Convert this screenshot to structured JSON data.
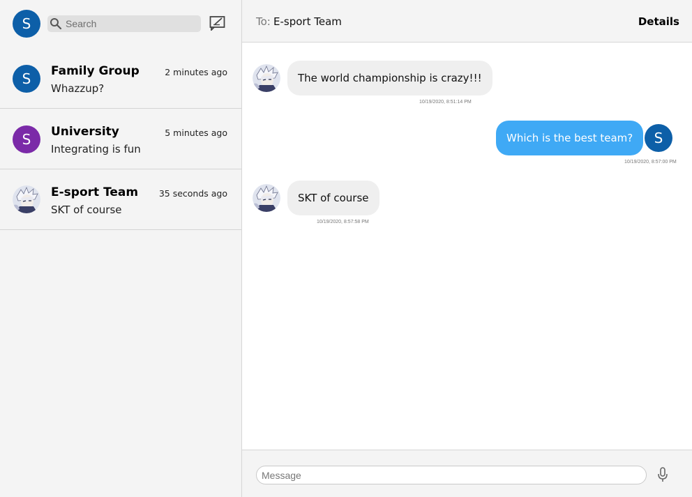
{
  "app": {
    "me_initial": "S"
  },
  "search": {
    "placeholder": "Search",
    "icon": "search-icon"
  },
  "compose": {
    "icon": "compose-icon"
  },
  "conversations": [
    {
      "name": "Family Group",
      "time": "2 minutes ago",
      "preview": "Whazzup?",
      "avatar_initial": "S",
      "avatar_color": "#0d5fa8"
    },
    {
      "name": "University",
      "time": "5 minutes ago",
      "preview": "Integrating is fun",
      "avatar_initial": "S",
      "avatar_color": "#7b2aa8"
    },
    {
      "name": "E-sport Team",
      "time": "35 seconds ago",
      "preview": "SKT of course",
      "avatar_image": "anime-character-avatar"
    }
  ],
  "chat": {
    "to_label": "To:",
    "to_name": "E-sport Team",
    "details_label": "Details",
    "messages": [
      {
        "direction": "incoming",
        "text": "The world championship is crazy!!!",
        "timestamp": "10/19/2020, 8:51:14 PM"
      },
      {
        "direction": "outgoing",
        "text": "Which is the best team?",
        "timestamp": "10/19/2020, 8:57:00 PM",
        "avatar_initial": "S"
      },
      {
        "direction": "incoming",
        "text": "SKT of course",
        "timestamp": "10/19/2020, 8:57:58 PM"
      }
    ]
  },
  "composer": {
    "placeholder": "Message",
    "mic_icon": "microphone-icon"
  },
  "colors": {
    "accent_blue": "#3fa9f5",
    "avatar_blue": "#0d5fa8",
    "avatar_purple": "#7b2aa8",
    "incoming_bubble": "#efefef",
    "sidebar_bg": "#f4f4f4"
  }
}
